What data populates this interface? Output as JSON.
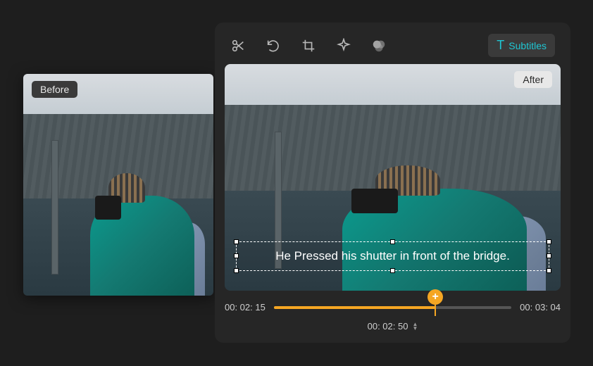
{
  "before": {
    "label": "Before"
  },
  "after": {
    "label": "After"
  },
  "toolbar": {
    "subtitles_label": "Subtitles"
  },
  "subtitle": {
    "text": "He Pressed his shutter in front of the bridge."
  },
  "timeline": {
    "start": "00: 02: 15",
    "end": "00: 03: 04",
    "current": "00: 02: 50",
    "add_symbol": "+"
  }
}
